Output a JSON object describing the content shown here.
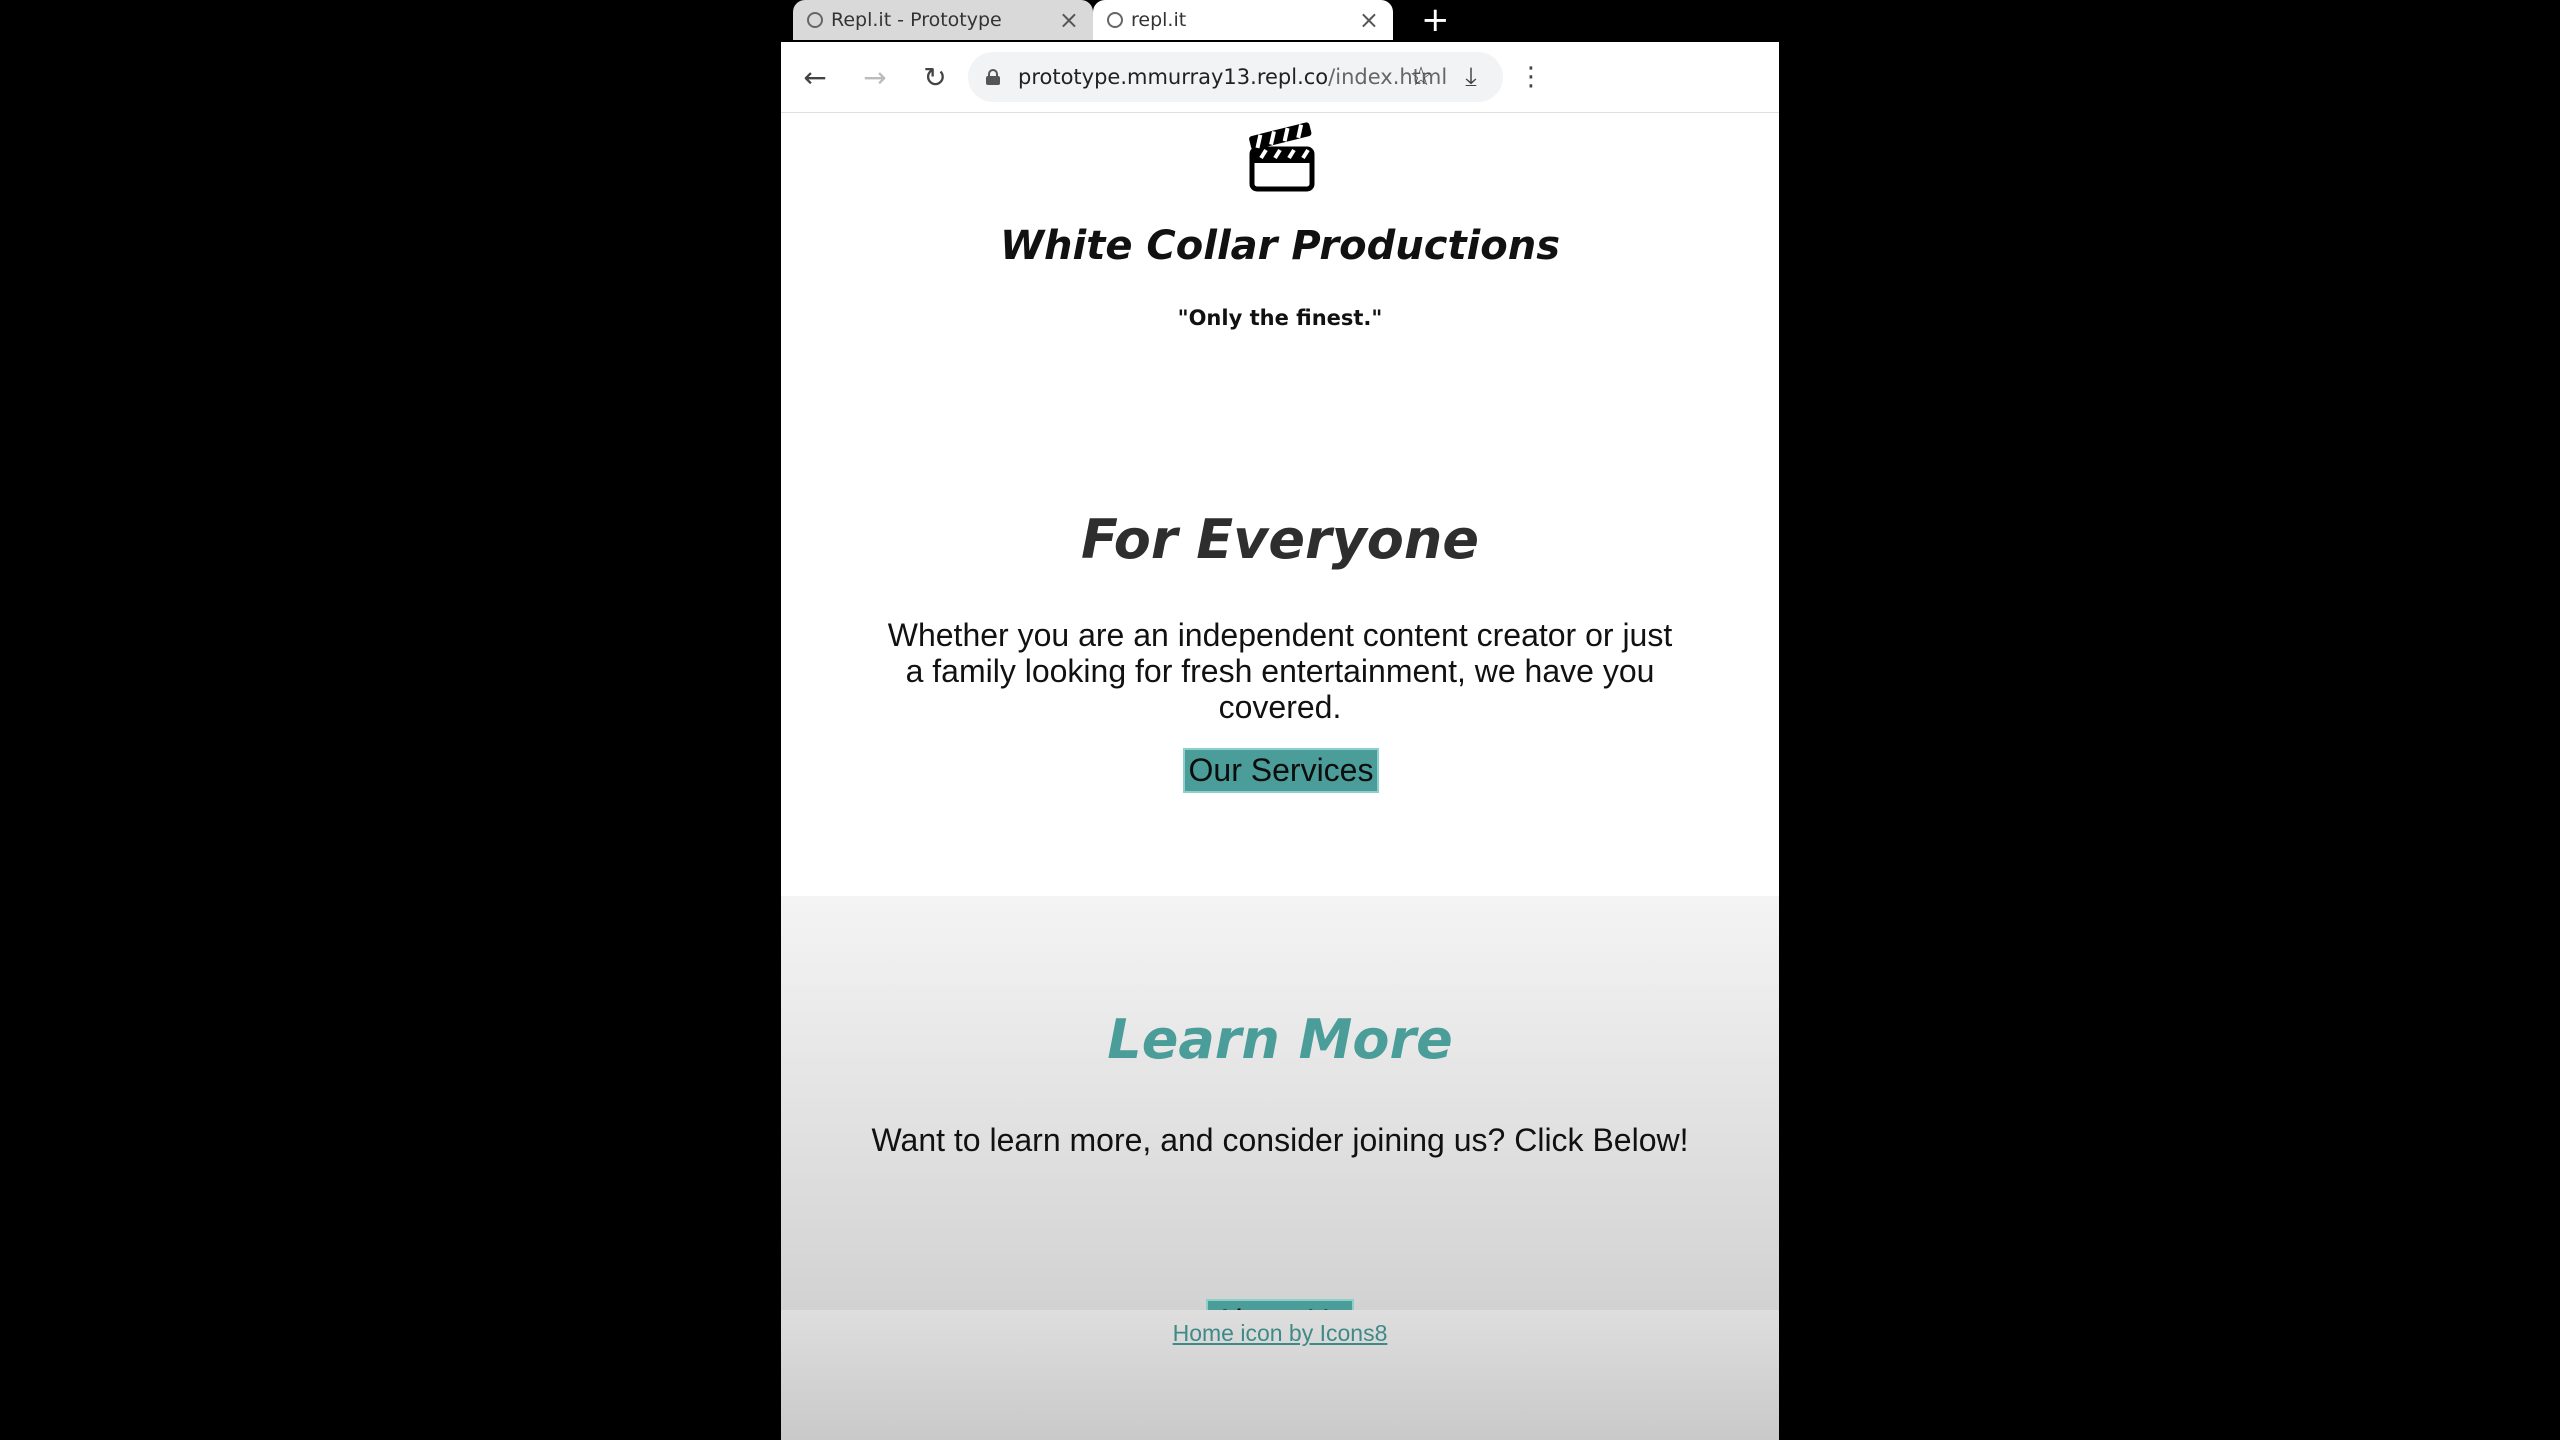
{
  "browser": {
    "tabs": [
      {
        "title": "Repl.it - Prototype",
        "close": "×"
      },
      {
        "title": "repl.it",
        "close": "×"
      }
    ],
    "new_tab": "+",
    "nav": {
      "back": "←",
      "forward": "→",
      "reload": "↻"
    },
    "url_host": "prototype.mmurray13.repl.co",
    "url_path": "/index.html",
    "icons": {
      "bookmark": "☆",
      "download": "⤓",
      "menu": "⋮"
    }
  },
  "hero": {
    "logo_icon": "clapperboard-icon",
    "brand": "White Collar Productions",
    "tagline": "\"Only the finest.\""
  },
  "everyone": {
    "title": "For Everyone",
    "text": "Whether you are an independent content creator or just a family looking for fresh entertainment, we have you covered.",
    "button": "Our Services"
  },
  "learn": {
    "title": "Learn More",
    "text": "Want to learn more, and consider joining us? Click Below!",
    "button": "About Us"
  },
  "footer": {
    "credit": "Home icon by Icons8"
  },
  "colors": {
    "accent": "#4a9d99",
    "link": "#3f8a87"
  }
}
